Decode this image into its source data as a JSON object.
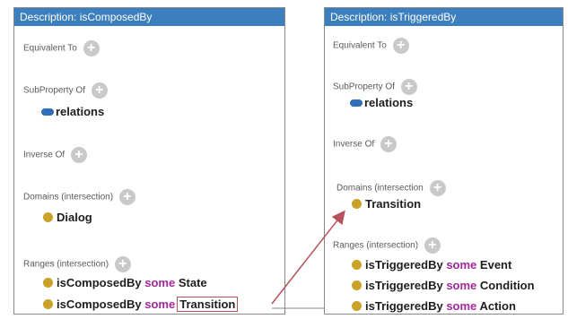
{
  "left_panel": {
    "title": "Description: isComposedBy",
    "equivalent_label": "Equivalent To",
    "subproperty_label": "SubProperty Of",
    "subproperty_value": "relations",
    "inverse_label": "Inverse Of",
    "domains_label": "Domains (intersection)",
    "domain_value": "Dialog",
    "ranges_label": "Ranges (intersection)",
    "ranges": [
      {
        "prop": "isComposedBy",
        "kw": "some",
        "cls": "State"
      },
      {
        "prop": "isComposedBy",
        "kw": "some",
        "cls": "Transition"
      }
    ]
  },
  "right_panel": {
    "title": "Description: isTriggeredBy",
    "equivalent_label": "Equivalent To",
    "subproperty_label": "SubProperty Of",
    "subproperty_value": "relations",
    "inverse_label": "Inverse Of",
    "domains_label": "Domains (intersection",
    "domain_value": "Transition",
    "ranges_label": "Ranges (intersection)",
    "ranges": [
      {
        "prop": "isTriggeredBy",
        "kw": "some",
        "cls": "Event"
      },
      {
        "prop": "isTriggeredBy",
        "kw": "some",
        "cls": "Condition"
      },
      {
        "prop": "isTriggeredBy",
        "kw": "some",
        "cls": "Action"
      }
    ]
  },
  "plus_symbol": "+",
  "colors": {
    "header": "#3b7fbe",
    "class_dot": "#c9a227",
    "property_dot": "#2f6fb8",
    "keyword": "#a1279a",
    "arrow": "#b5525b"
  },
  "icons": {
    "add": "plus-circle-icon",
    "class": "class-dot-icon",
    "property": "object-property-icon",
    "link": "arrow-icon"
  }
}
